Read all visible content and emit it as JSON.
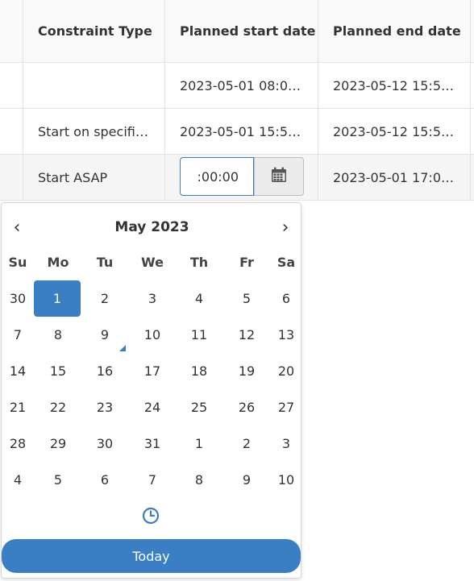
{
  "table": {
    "headers": [
      "",
      "Constraint Type",
      "Planned start date",
      "Planned end date"
    ],
    "rows": [
      {
        "constraint_type": "",
        "start": "2023-05-01 08:0…",
        "end": "2023-05-12 15:5…"
      },
      {
        "constraint_type": "Start on specifi…",
        "start": "2023-05-01 15:5…",
        "end": "2023-05-12 15:5…"
      },
      {
        "constraint_type": "Start ASAP",
        "start": "",
        "end": "2023-05-01 17:0…"
      }
    ],
    "editing_value": ":00:00"
  },
  "datepicker": {
    "prev": "‹",
    "next": "›",
    "month_title": "May 2023",
    "weekdays": [
      "Su",
      "Mo",
      "Tu",
      "We",
      "Th",
      "Fr",
      "Sa"
    ],
    "weeks": [
      [
        "30",
        "1",
        "2",
        "3",
        "4",
        "5",
        "6"
      ],
      [
        "7",
        "8",
        "9",
        "10",
        "11",
        "12",
        "13"
      ],
      [
        "14",
        "15",
        "16",
        "17",
        "18",
        "19",
        "20"
      ],
      [
        "21",
        "22",
        "23",
        "24",
        "25",
        "26",
        "27"
      ],
      [
        "28",
        "29",
        "30",
        "31",
        "1",
        "2",
        "3"
      ],
      [
        "4",
        "5",
        "6",
        "7",
        "8",
        "9",
        "10"
      ]
    ],
    "selected_day": "1",
    "today_day": "9",
    "today_label": "Today",
    "accent": "#3a7ec4",
    "icons": {
      "calendar": "calendar-icon",
      "clock": "clock-icon"
    }
  }
}
